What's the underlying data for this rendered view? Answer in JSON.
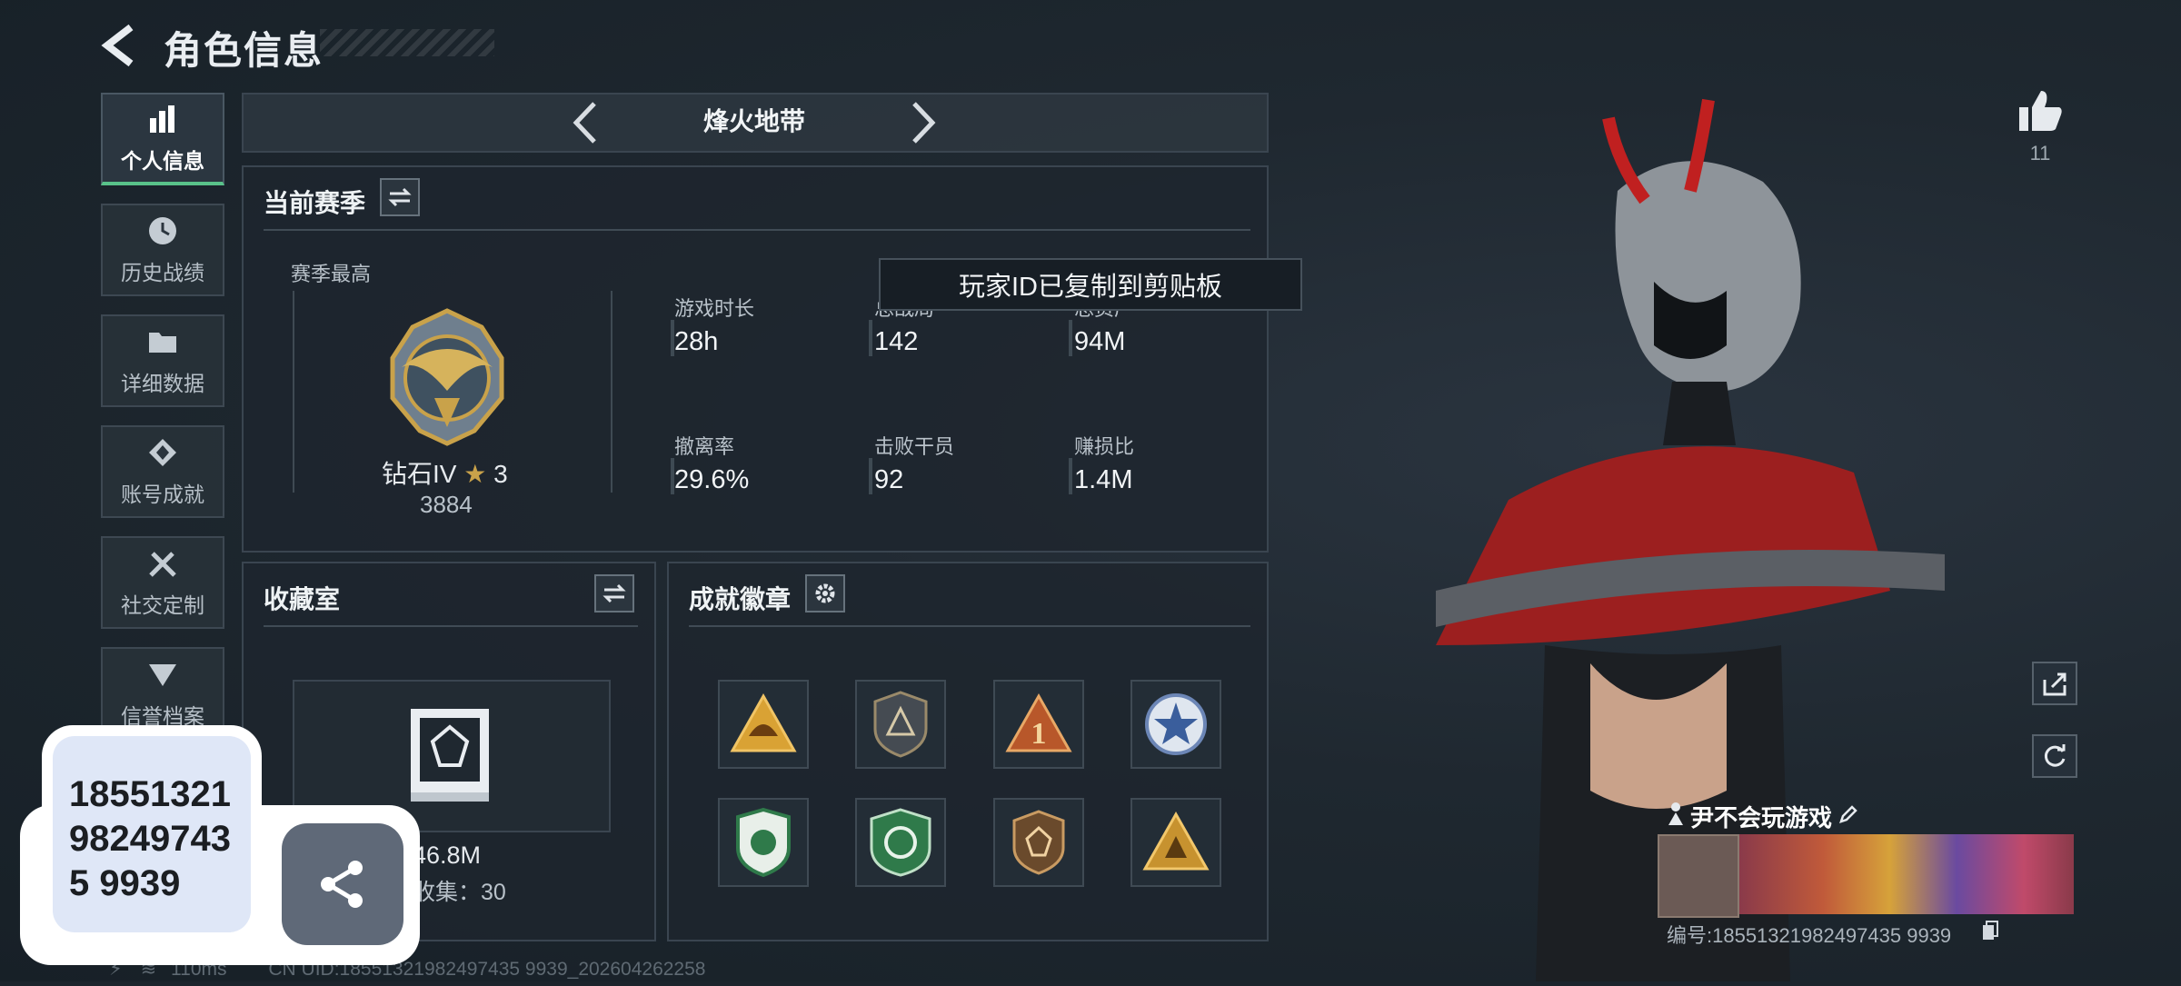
{
  "header": {
    "title": "角色信息"
  },
  "sidebar": {
    "items": [
      {
        "label": "个人信息",
        "icon": "bar-chart-icon",
        "active": true
      },
      {
        "label": "历史战绩",
        "icon": "clock-icon"
      },
      {
        "label": "详细数据",
        "icon": "folder-icon"
      },
      {
        "label": "账号成就",
        "icon": "medal-icon"
      },
      {
        "label": "社交定制",
        "icon": "tools-icon"
      },
      {
        "label": "信誉档案",
        "icon": "shield-icon"
      }
    ]
  },
  "mode": {
    "label": "烽火地带"
  },
  "season": {
    "title": "当前赛季",
    "best_label": "赛季最高",
    "rank_name": "钻石IV",
    "rank_stars": "3",
    "rank_score": "3884",
    "stats": [
      {
        "label": "游戏时长",
        "value": "28h"
      },
      {
        "label": "总战局",
        "value": "142"
      },
      {
        "label": "总资产",
        "value": "94M"
      },
      {
        "label": "撤离率",
        "value": "29.6%"
      },
      {
        "label": "击败干员",
        "value": "92"
      },
      {
        "label": "赚损比",
        "value": "1.4M"
      }
    ]
  },
  "toast": {
    "text": "玩家ID已复制到剪贴板"
  },
  "collection": {
    "title": "收藏室",
    "value": "46.8M",
    "count_text": "收集：30"
  },
  "achievements": {
    "title": "成就徽章"
  },
  "profile": {
    "like_count": "11",
    "player_name": "尹不会玩游戏",
    "player_no": "编号:18551321982497435 9939"
  },
  "footer": {
    "ping": "110ms",
    "uid": "CN UID:18551321982497435 9939_202604262258"
  },
  "popup": {
    "id_text": "18551321982497435 9939"
  },
  "colors": {
    "accent_green": "#59c28a",
    "panel_border": "#3a4550",
    "rank_gold": "#c9a24a"
  }
}
